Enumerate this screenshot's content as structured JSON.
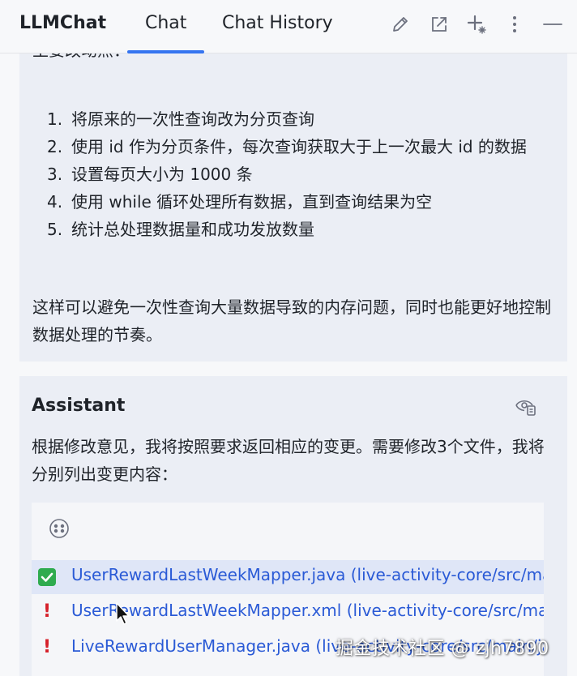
{
  "header": {
    "app_title": "LLMChat",
    "tabs": [
      {
        "label": "Chat",
        "active": true
      },
      {
        "label": "Chat History",
        "active": false
      }
    ],
    "icons": [
      "edit-icon",
      "open-external-icon",
      "new-chat-icon",
      "more-icon",
      "minimize-icon"
    ]
  },
  "message1": {
    "clipped_text": "主要改动点：",
    "list": [
      {
        "num": "1.",
        "text": "将原来的一次性查询改为分页查询"
      },
      {
        "num": "2.",
        "text": "使用 id 作为分页条件，每次查询获取大于上一次最大 id 的数据"
      },
      {
        "num": "3.",
        "text": "设置每页大小为 1000 条"
      },
      {
        "num": "4.",
        "text": "使用 while 循环处理所有数据，直到查询结果为空"
      },
      {
        "num": "5.",
        "text": "统计总处理数据量和成功发放数量"
      }
    ],
    "paragraph": "这样可以避免一次性查询大量数据导致的内存问题，同时也能更好地控制数据处理的节奏。"
  },
  "message2": {
    "role": "Assistant",
    "text": "根据修改意见，我将按照要求返回相应的变更。需要修改3个文件，我将分别列出变更内容：",
    "files": [
      {
        "status": "applied",
        "label": "UserRewardLastWeekMapper.java (live-activity-core/src/main/java"
      },
      {
        "status": "error",
        "label": "UserRewardLastWeekMapper.xml (live-activity-core/src/main/resources"
      },
      {
        "status": "error",
        "label": "LiveRewardUserManager.java (live-activity-core/src/main/java"
      }
    ]
  },
  "watermark": "掘金技术社区 @ zjh7890",
  "colors": {
    "accent": "#3574f0",
    "link": "#2a5ad6",
    "error": "#d6202a",
    "success": "#2fab4f",
    "message_bg": "#ebeef5"
  }
}
